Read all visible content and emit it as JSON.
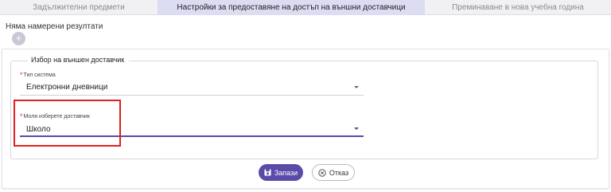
{
  "tabs": [
    {
      "label": "Задължителни предмети",
      "active": false
    },
    {
      "label": "Настройки за предоставяне на достъп на външни доставчици",
      "active": true
    },
    {
      "label": "Преминаване в нова учебна година",
      "active": false
    }
  ],
  "no_results_text": "Няма намерени резултати",
  "add_button_icon": "plus-icon",
  "form": {
    "legend": "Избор на външен доставчик",
    "system_type": {
      "required_mark": "*",
      "label": "Тип система",
      "value": "Електронни дневници"
    },
    "provider": {
      "required_mark": "*",
      "label": "Моля изберете доставчик",
      "value": "Школо"
    }
  },
  "actions": {
    "save_label": "Запази",
    "cancel_label": "Отказ"
  },
  "colors": {
    "accent": "#5b4aa8",
    "active_tab_bg": "#dcdcf3",
    "highlight": "#e02020",
    "required": "#e53935"
  }
}
